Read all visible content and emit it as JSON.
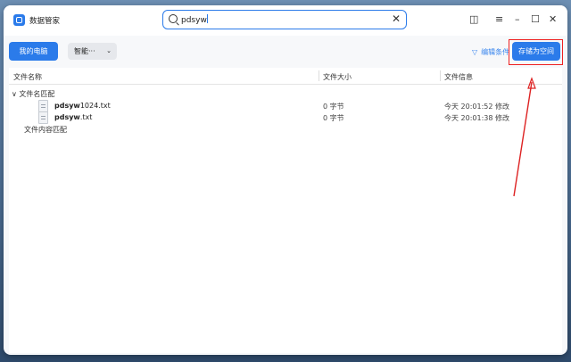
{
  "app": {
    "title": "数据管家"
  },
  "search": {
    "value": "pdsyw"
  },
  "toolbar": {
    "my_computer": "我的电脑",
    "smart_dropdown": "智能···",
    "filter_label": "编辑条件",
    "save_to_space": "存储为空间"
  },
  "table": {
    "columns": [
      "文件名称",
      "文件大小",
      "文件信息"
    ],
    "groups": {
      "name_match": "文件名匹配",
      "content_match": "文件内容匹配"
    },
    "rows": [
      {
        "name_bold": "pdsyw",
        "name_rest": "1024.txt",
        "size": "0 字节",
        "info": "今天 20:01:52 修改"
      },
      {
        "name_bold": "pdsyw",
        "name_rest": ".txt",
        "size": "0 字节",
        "info": "今天 20:01:38 修改"
      }
    ]
  },
  "colors": {
    "accent": "#2b7bea",
    "annotation": "#e22222"
  },
  "icons": [
    "app-icon",
    "search-icon",
    "clear-icon",
    "sidebar-toggle-icon",
    "menu-icon",
    "minimize-icon",
    "maximize-icon",
    "close-icon",
    "filter-icon",
    "chevron-down-icon",
    "file-icon"
  ]
}
